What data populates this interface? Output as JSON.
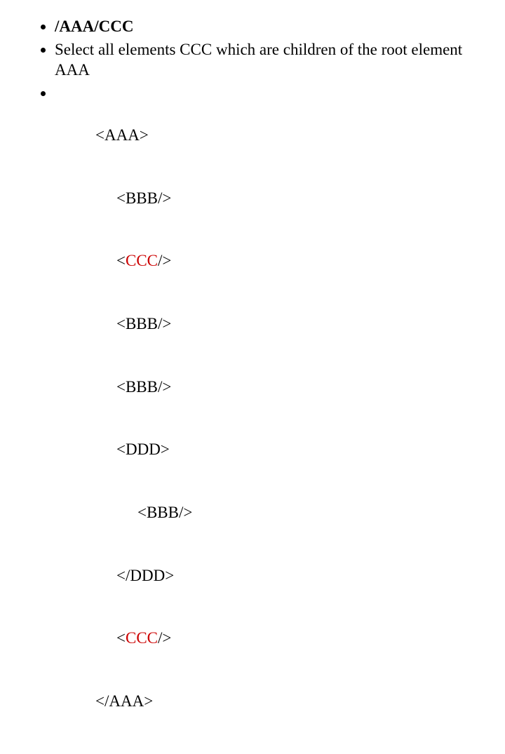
{
  "bullets": {
    "xpath": "/AAA/CCC",
    "description": "Select all elements CCC which are children of the root element AAA"
  },
  "code": {
    "l0_open": "<AAA>",
    "l1_bbb": "<BBB/>",
    "l2_open": "<",
    "l2_ccc": "CCC",
    "l2_close": "/>",
    "l3_bbb": "<BBB/>",
    "l4_bbb": "<BBB/>",
    "l5_ddd_open": "<DDD>",
    "l6_bbb": "<BBB/>",
    "l7_ddd_close": "</DDD>",
    "l8_open": "<",
    "l8_ccc": "CCC",
    "l8_close": "/>",
    "l9_close": "</AAA>"
  }
}
